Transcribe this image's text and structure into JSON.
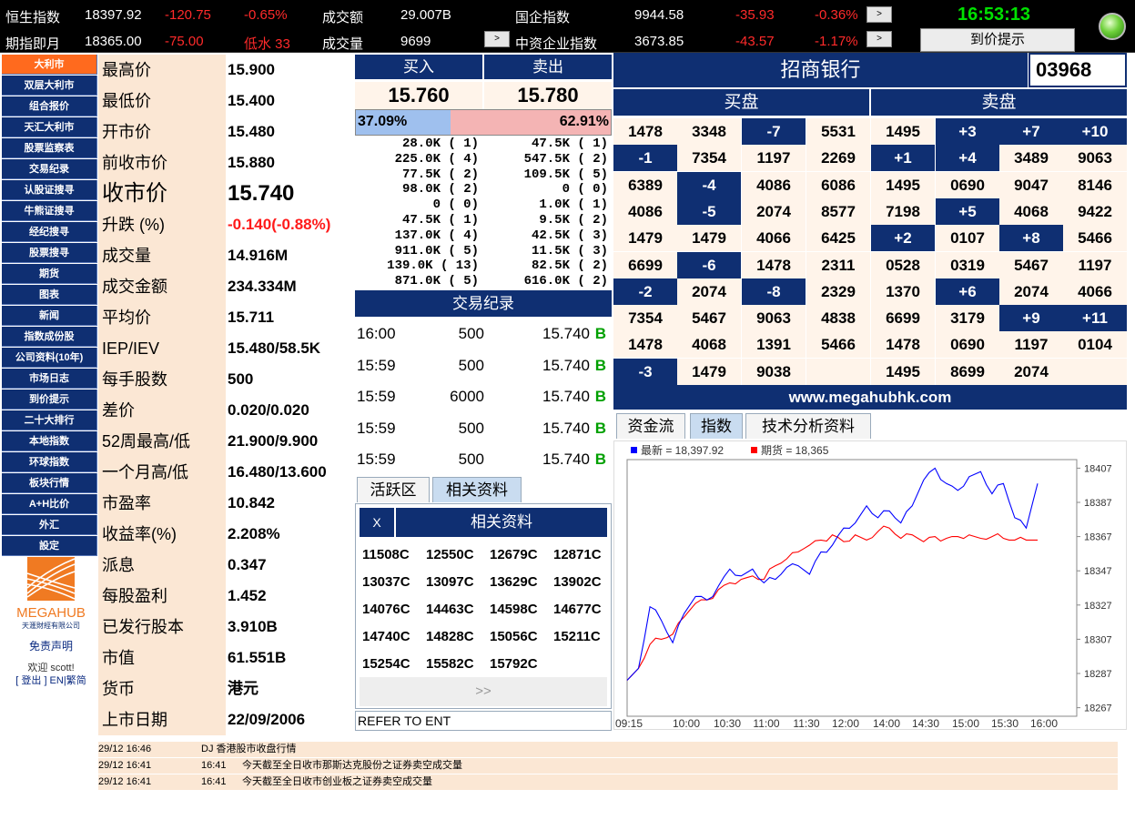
{
  "top": {
    "r1": {
      "hsi_label": "恒生指数",
      "hsi_val": "18397.92",
      "hsi_chg": "-120.75",
      "hsi_pct": "-0.65%",
      "turnover_label": "成交额",
      "turnover_val": "29.007B",
      "hscei_label": "国企指数",
      "hscei_val": "9944.58",
      "hscei_chg": "-35.93",
      "hscei_pct": "-0.36%"
    },
    "r2": {
      "fut_label": "期指即月",
      "fut_val": "18365.00",
      "fut_chg": "-75.00",
      "fut_disc": "低水 33",
      "vol_label": "成交量",
      "vol_val": "9699",
      "hscci_label": "中资企业指数",
      "hscci_val": "3673.85",
      "hscci_chg": "-43.57",
      "hscci_pct": "-1.17%"
    },
    "btn": ">",
    "clock": "16:53:13",
    "alert": "到价提示"
  },
  "sidebar": [
    "大利市",
    "双层大利市",
    "组合报价",
    "天汇大利市",
    "股票监察表",
    "交易纪录",
    "认股证搜寻",
    "牛熊证搜寻",
    "经纪搜寻",
    "股票搜寻",
    "期货",
    "图表",
    "新闻",
    "指数成份股",
    "公司资料(10年)",
    "市场日志",
    "到价提示",
    "二十大排行",
    "本地指数",
    "环球指数",
    "板块行情",
    "A+H比价",
    "外汇",
    "設定"
  ],
  "brand": {
    "logo": "MEGAHUB",
    "logo_sub": "天滙財經有限公司",
    "disclaimer": "免责声明",
    "welcome": "欢迎 scott!",
    "links": "[ 登出 ] EN|繁简"
  },
  "quote": [
    {
      "label": "最高价",
      "value": "15.900"
    },
    {
      "label": "最低价",
      "value": "15.400"
    },
    {
      "label": "开市价",
      "value": "15.480"
    },
    {
      "label": "前收市价",
      "value": "15.880"
    },
    {
      "label": "收市价",
      "value": "15.740"
    },
    {
      "label": "升跌 (%)",
      "value": "-0.140(-0.88%)"
    },
    {
      "label": "成交量",
      "value": "14.916M"
    },
    {
      "label": "成交金额",
      "value": "234.334M"
    },
    {
      "label": "平均价",
      "value": "15.711"
    },
    {
      "label": "IEP/IEV",
      "value": "15.480/58.5K"
    },
    {
      "label": "每手股数",
      "value": "500"
    },
    {
      "label": "差价",
      "value": "0.020/0.020"
    },
    {
      "label": "52周最高/低",
      "value": "21.900/9.900"
    },
    {
      "label": "一个月高/低",
      "value": "16.480/13.600"
    },
    {
      "label": "市盈率",
      "value": "10.842"
    },
    {
      "label": "收益率(%)",
      "value": "2.208%"
    },
    {
      "label": "派息",
      "value": "0.347"
    },
    {
      "label": "每股盈利",
      "value": "1.452"
    },
    {
      "label": "已发行股本",
      "value": "3.910B"
    },
    {
      "label": "市值",
      "value": "61.551B"
    },
    {
      "label": "货币",
      "value": "港元"
    },
    {
      "label": "上市日期",
      "value": "22/09/2006"
    }
  ],
  "bidask": {
    "bid_label": "买入",
    "ask_label": "卖出",
    "bid": "15.760",
    "ask": "15.780",
    "bid_pct": "37.09%",
    "ask_pct": "62.91%",
    "bid_ratio": 0.3709
  },
  "depth": [
    {
      "b": "28.0K ( 1)",
      "a": "47.5K ( 1)"
    },
    {
      "b": "225.0K ( 4)",
      "a": "547.5K ( 2)"
    },
    {
      "b": "77.5K ( 2)",
      "a": "109.5K ( 5)"
    },
    {
      "b": "98.0K ( 2)",
      "a": "0 ( 0)"
    },
    {
      "b": "0 ( 0)",
      "a": "1.0K ( 1)"
    },
    {
      "b": "47.5K ( 1)",
      "a": "9.5K ( 2)"
    },
    {
      "b": "137.0K ( 4)",
      "a": "42.5K ( 3)"
    },
    {
      "b": "911.0K ( 5)",
      "a": "11.5K ( 3)"
    },
    {
      "b": "139.0K ( 13)",
      "a": "82.5K ( 2)"
    },
    {
      "b": "871.0K ( 5)",
      "a": "616.0K ( 2)"
    }
  ],
  "trades": {
    "title": "交易纪录",
    "rows": [
      {
        "t": "16:00",
        "q": "500",
        "p": "15.740",
        "s": "B"
      },
      {
        "t": "15:59",
        "q": "500",
        "p": "15.740",
        "s": "B"
      },
      {
        "t": "15:59",
        "q": "6000",
        "p": "15.740",
        "s": "B"
      },
      {
        "t": "15:59",
        "q": "500",
        "p": "15.740",
        "s": "B"
      },
      {
        "t": "15:59",
        "q": "500",
        "p": "15.740",
        "s": "B"
      }
    ]
  },
  "related": {
    "tab1": "活跃区",
    "tab2": "相关资料",
    "close": "X",
    "title": "相关资料",
    "codes": [
      "11508C",
      "12550C",
      "12679C",
      "12871C",
      "13037C",
      "13097C",
      "13629C",
      "13902C",
      "14076C",
      "14463C",
      "14598C",
      "14677C",
      "14740C",
      "14828C",
      "15056C",
      "15211C",
      "15254C",
      "15582C",
      "15792C"
    ],
    "more": ">>",
    "footer": "REFER TO ENT"
  },
  "stock": {
    "name": "招商银行",
    "code": "03968",
    "bid_queue": "买盘",
    "ask_queue": "卖盘"
  },
  "queue": [
    [
      "1478",
      "3348",
      "-7",
      "5531",
      "1495",
      "+3",
      "+7",
      "+10"
    ],
    [
      "-1",
      "7354",
      "1197",
      "2269",
      "+1",
      "+4",
      "3489",
      "9063"
    ],
    [
      "6389",
      "-4",
      "4086",
      "6086",
      "1495",
      "0690",
      "9047",
      "8146"
    ],
    [
      "4086",
      "-5",
      "2074",
      "8577",
      "7198",
      "+5",
      "4068",
      "9422"
    ],
    [
      "1479",
      "1479",
      "4066",
      "6425",
      "+2",
      "0107",
      "+8",
      "5466"
    ],
    [
      "6699",
      "-6",
      "1478",
      "2311",
      "0528",
      "0319",
      "5467",
      "1197"
    ],
    [
      "-2",
      "2074",
      "-8",
      "2329",
      "1370",
      "+6",
      "2074",
      "4066"
    ],
    [
      "7354",
      "5467",
      "9063",
      "4838",
      "6699",
      "3179",
      "+9",
      "+11"
    ],
    [
      "1478",
      "4068",
      "1391",
      "5466",
      "1478",
      "0690",
      "1197",
      "0104"
    ],
    [
      "-3",
      "1479",
      "9038",
      "",
      "1495",
      "8699",
      "2074",
      ""
    ]
  ],
  "url": "www.megahubhk.com",
  "charttabs": [
    "资金流",
    "指数",
    "技术分析资料"
  ],
  "chart_data": {
    "type": "line",
    "legend_position": "top-left",
    "series": [
      {
        "name": "最新 = 18,397.92",
        "color": "#0000ff"
      },
      {
        "name": "期货 = 18,365",
        "color": "#ff0000"
      }
    ],
    "x_ticks": [
      "09:15",
      "10:00",
      "10:30",
      "11:00",
      "11:30",
      "12:00",
      "14:00",
      "14:30",
      "15:00",
      "15:30",
      "16:00"
    ],
    "y_ticks": [
      18407,
      18387,
      18367,
      18347,
      18327,
      18307,
      18287,
      18267
    ],
    "ylim": [
      18262,
      18412
    ],
    "blue": [
      [
        0,
        18283
      ],
      [
        3,
        18290
      ],
      [
        6,
        18326
      ],
      [
        9,
        18318
      ],
      [
        12,
        18305
      ],
      [
        15,
        18322
      ],
      [
        18,
        18332
      ],
      [
        21,
        18330
      ],
      [
        24,
        18338
      ],
      [
        27,
        18348
      ],
      [
        30,
        18344
      ],
      [
        33,
        18348
      ],
      [
        36,
        18340
      ],
      [
        39,
        18342
      ],
      [
        42,
        18349
      ],
      [
        45,
        18350
      ],
      [
        48,
        18345
      ],
      [
        51,
        18358
      ],
      [
        54,
        18362
      ],
      [
        57,
        18372
      ],
      [
        60,
        18375
      ],
      [
        63,
        18385
      ],
      [
        66,
        18378
      ],
      [
        69,
        18382
      ],
      [
        72,
        18375
      ],
      [
        75,
        18385
      ],
      [
        78,
        18400
      ],
      [
        81,
        18407
      ],
      [
        84,
        18398
      ],
      [
        87,
        18394
      ],
      [
        90,
        18402
      ],
      [
        93,
        18405
      ],
      [
        96,
        18392
      ],
      [
        99,
        18398
      ],
      [
        102,
        18378
      ],
      [
        105,
        18372
      ],
      [
        108,
        18398
      ]
    ],
    "red": [
      [
        0,
        18283
      ],
      [
        3,
        18290
      ],
      [
        6,
        18304
      ],
      [
        9,
        18307
      ],
      [
        12,
        18310
      ],
      [
        15,
        18320
      ],
      [
        18,
        18328
      ],
      [
        21,
        18330
      ],
      [
        24,
        18336
      ],
      [
        27,
        18340
      ],
      [
        30,
        18342
      ],
      [
        33,
        18344
      ],
      [
        36,
        18342
      ],
      [
        39,
        18350
      ],
      [
        42,
        18354
      ],
      [
        45,
        18358
      ],
      [
        48,
        18362
      ],
      [
        51,
        18365
      ],
      [
        54,
        18368
      ],
      [
        57,
        18364
      ],
      [
        60,
        18368
      ],
      [
        63,
        18365
      ],
      [
        66,
        18370
      ],
      [
        69,
        18372
      ],
      [
        72,
        18366
      ],
      [
        75,
        18368
      ],
      [
        78,
        18364
      ],
      [
        81,
        18367
      ],
      [
        84,
        18366
      ],
      [
        87,
        18367
      ],
      [
        90,
        18368
      ],
      [
        93,
        18366
      ],
      [
        96,
        18367
      ],
      [
        99,
        18366
      ],
      [
        102,
        18365
      ],
      [
        105,
        18365
      ],
      [
        108,
        18365
      ]
    ]
  },
  "news": [
    {
      "d": "29/12 16:46",
      "t": "",
      "h": "DJ 香港股市收盘行情"
    },
    {
      "d": "29/12 16:41",
      "t": "16:41",
      "h": "今天截至全日收市那斯达克股份之证券卖空成交量"
    },
    {
      "d": "29/12 16:41",
      "t": "16:41",
      "h": "今天截至全日收市创业板之证券卖空成交量"
    }
  ]
}
